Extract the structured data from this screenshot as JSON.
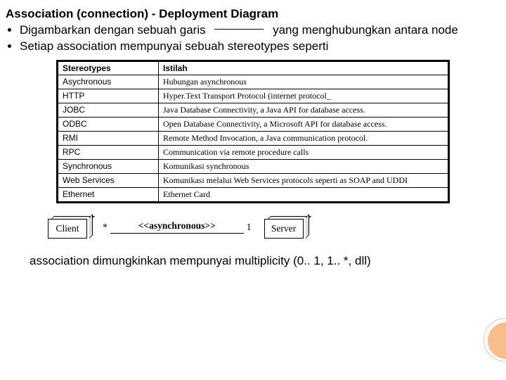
{
  "title": "Association (connection) - Deployment Diagram",
  "bullets": {
    "b1a": "Digambarkan dengan sebuah garis",
    "b1b": "yang menghubungkan antara node",
    "b2": "Setiap association mempunyai sebuah stereotypes seperti"
  },
  "table": {
    "head": {
      "c1": "Stereotypes",
      "c2": "Istilah"
    },
    "rows": [
      {
        "c1": "Asychronous",
        "c2": "Hubungan asynchronous"
      },
      {
        "c1": "HTTP",
        "c2": "Hyper.Text Transport Protocol (internet protocol_"
      },
      {
        "c1": "JOBC",
        "c2": "Java Database Connectivity, a Java API for database access."
      },
      {
        "c1": "ODBC",
        "c2": "Open Database Connectivity, a Microsoft API for database access."
      },
      {
        "c1": "RMI",
        "c2": "Remote Method Invocation, a Java communication protocol."
      },
      {
        "c1": "RPC",
        "c2": "Communication via remote procedure calls"
      },
      {
        "c1": "Synchronous",
        "c2": "Komunikasi synchronous"
      },
      {
        "c1": "Web Services",
        "c2": "Komunikasi melalui Web Services protocols seperti as SOAP and UDDI"
      },
      {
        "c1": "Ethernet",
        "c2": "Ethernet Card"
      }
    ]
  },
  "assoc": {
    "left_node": "Client",
    "left_mult": "*",
    "label": "<<asynchronous>>",
    "right_mult": "1",
    "right_node": "Server"
  },
  "footer": "association dimungkinkan mempunyai multiplicity (0.. 1, 1.. *, dll)"
}
